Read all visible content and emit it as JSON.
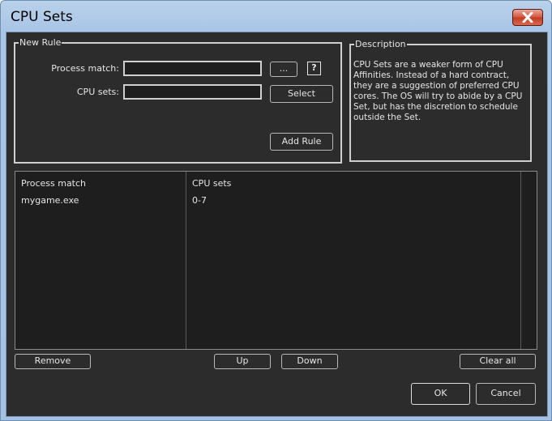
{
  "window": {
    "title": "CPU Sets"
  },
  "new_rule": {
    "legend": "New Rule",
    "process_match_label": "Process match:",
    "process_match_value": "",
    "browse_label": "...",
    "help_label": "?",
    "cpu_sets_label": "CPU sets:",
    "cpu_sets_value": "",
    "select_label": "Select",
    "add_rule_label": "Add Rule"
  },
  "description": {
    "legend": "Description",
    "text": "CPU Sets are a weaker form of CPU Affinities. Instead of a hard contract, they are a suggestion of preferred CPU cores. The OS will try to abide by a CPU Set, but has the discretion to schedule outside the Set."
  },
  "table": {
    "columns": [
      "Process match",
      "CPU sets"
    ],
    "rows": [
      {
        "process": "mygame.exe",
        "cpu_sets": "0-7"
      }
    ]
  },
  "buttons": {
    "remove": "Remove",
    "up": "Up",
    "down": "Down",
    "clear_all": "Clear all",
    "ok": "OK",
    "cancel": "Cancel"
  },
  "colors": {
    "client_bg": "#2c2c2c",
    "list_bg": "#1e1e1e",
    "text": "#e6e6e6",
    "frame": "#b9d1ea",
    "close": "#c23a22"
  }
}
